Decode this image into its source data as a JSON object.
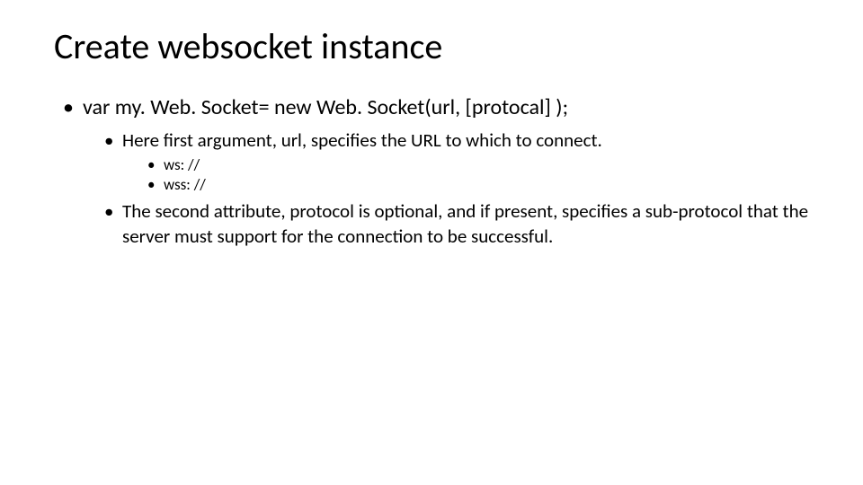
{
  "title": "Create websocket instance",
  "bullets": {
    "l1": {
      "code": "var my. Web. Socket= new Web. Socket(url, [protocal] );"
    },
    "l2a": "Here first argument, url, specifies the URL to which to connect.",
    "l3a": "ws: //",
    "l3b": "wss: //",
    "l2b": "The second attribute, protocol is optional, and if present, specifies a sub-protocol that the server must support for the connection to be successful."
  }
}
